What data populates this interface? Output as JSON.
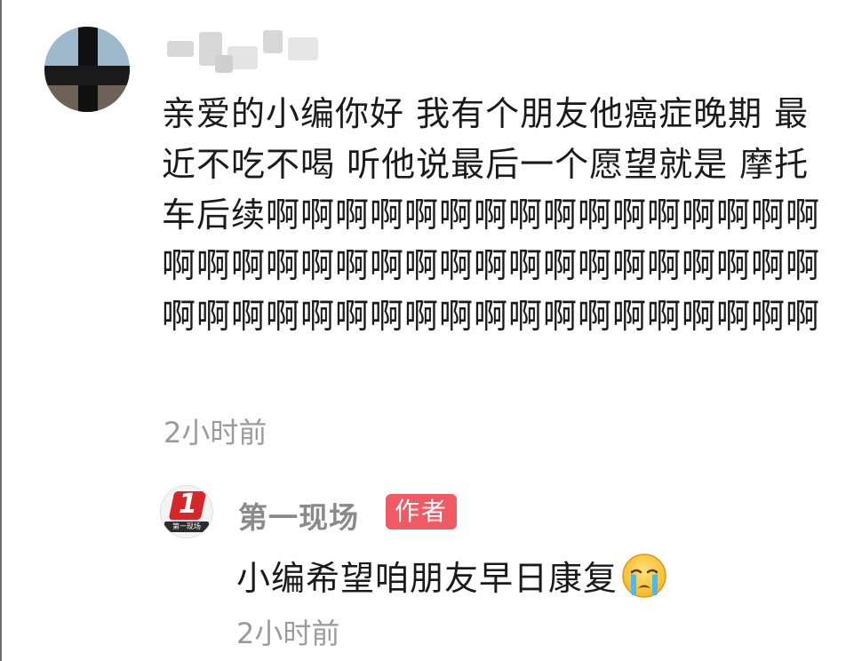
{
  "comment": {
    "text": "亲爱的小编你好 我有个朋友他癌症晚期 最近不吃不喝 听他说最后一个愿望就是 摩托车后续啊啊啊啊啊啊啊啊啊啊啊啊啊啊啊啊啊啊啊啊啊啊啊啊啊啊啊啊啊啊啊啊啊啊啊啊啊啊啊啊啊啊啊啊啊啊啊啊啊啊啊啊啊啊",
    "time": "2小时前"
  },
  "reply": {
    "name": "第一现场",
    "badge": "作者",
    "text": "小编希望咱朋友早日康复",
    "emoji": "crying-face",
    "time": "2小时前",
    "logo_number": "1",
    "logo_caption": "第一现场"
  },
  "colors": {
    "badge": "#f05a63",
    "timestamp": "#9a9a9a",
    "reply_name": "#8a8a8a",
    "text": "#1a1a1a"
  }
}
